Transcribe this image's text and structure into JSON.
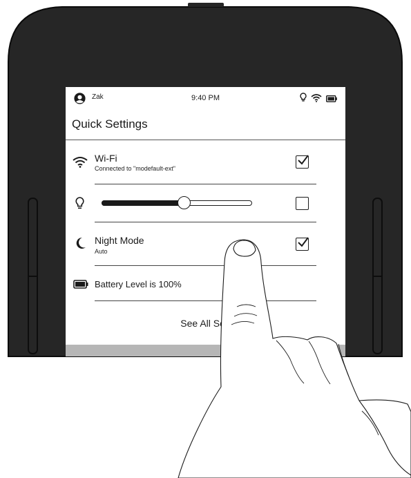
{
  "status_bar": {
    "user_name": "Zak",
    "time": "9:40 PM",
    "icons": [
      "light-bulb-icon",
      "wifi-icon",
      "battery-icon"
    ]
  },
  "quick_settings": {
    "title": "Quick Settings",
    "wifi": {
      "label": "Wi-Fi",
      "status": "Connected to \"modefault-ext\"",
      "checked": true,
      "icon": "wifi-icon"
    },
    "light": {
      "icon": "light-bulb-icon",
      "level": 0.55,
      "auto_checked": false
    },
    "night_mode": {
      "label": "Night Mode",
      "status": "Auto",
      "checked": true,
      "icon": "moon-icon"
    },
    "battery": {
      "label": "Battery Level is 100%",
      "icon": "battery-icon"
    },
    "see_all": "See All Sett"
  },
  "colors": {
    "bezel": "#262626",
    "screen": "#ffffff",
    "ink": "#1a1a1a",
    "band": "#b6b6b6"
  }
}
